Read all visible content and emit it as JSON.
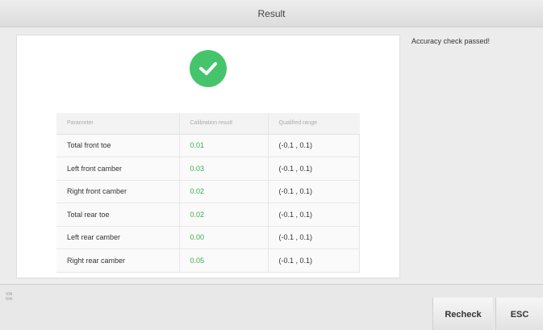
{
  "window": {
    "title": "Result"
  },
  "status": {
    "icon": "check-circle-icon",
    "color": "#46c46c",
    "message": "Accuracy check passed!"
  },
  "table": {
    "headers": [
      "Parameter",
      "Calibration result",
      "Qualified range"
    ],
    "rows": [
      {
        "parameter": "Total front toe",
        "result": "0.01",
        "range": "(-0.1 , 0.1)"
      },
      {
        "parameter": "Left front camber",
        "result": "0.03",
        "range": "(-0.1 , 0.1)"
      },
      {
        "parameter": "Right front camber",
        "result": "0.02",
        "range": "(-0.1 , 0.1)"
      },
      {
        "parameter": "Total rear toe",
        "result": "0.02",
        "range": "(-0.1 , 0.1)"
      },
      {
        "parameter": "Left rear camber",
        "result": "0.00",
        "range": "(-0.1 , 0.1)"
      },
      {
        "parameter": "Right rear camber",
        "result": "0.05",
        "range": "(-0.1 , 0.1)"
      }
    ]
  },
  "footer": {
    "vin_label": "VIN",
    "vin_value": "N/A",
    "recheck_label": "Recheck",
    "esc_label": "ESC"
  }
}
